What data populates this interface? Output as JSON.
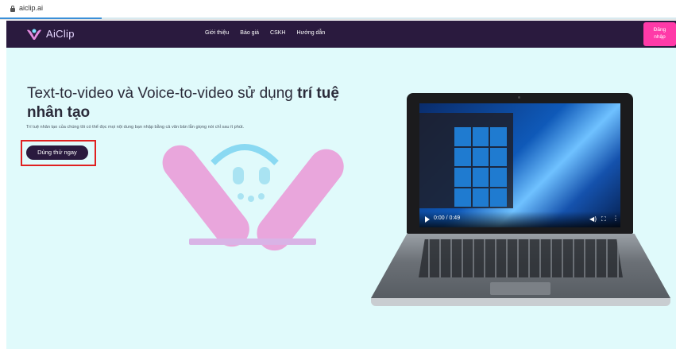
{
  "browser": {
    "url": "aiclip.ai",
    "load_progress": 0.15
  },
  "nav": {
    "brand": "AiClip",
    "menu": [
      "Giới thiệu",
      "Báo giá",
      "CSKH",
      "Hướng dẫn"
    ],
    "login_line1": "Đăng",
    "login_line2": "nhập"
  },
  "hero": {
    "headline_normal": "Text-to-video và Voice-to-video sử dụng ",
    "headline_bold": "trí tuệ nhân tạo",
    "subtext": "Trí tuệ nhân tạo của chúng tôi có thể đọc mọi nội dung bạn nhập bằng cả văn bản lẫn giọng nói chỉ sau ít phút.",
    "cta_label": "Dùng thử ngay"
  },
  "video": {
    "time": "0:00 / 0:49"
  },
  "colors": {
    "nav_bg": "#2a1a3e",
    "hero_bg": "#e0fafb",
    "accent_pink": "#ff3aa8",
    "highlight_red": "#e02020"
  },
  "icons": [
    "lock-icon",
    "aiclip-logo-icon",
    "play-icon",
    "volume-icon",
    "fullscreen-icon",
    "more-options-icon"
  ]
}
